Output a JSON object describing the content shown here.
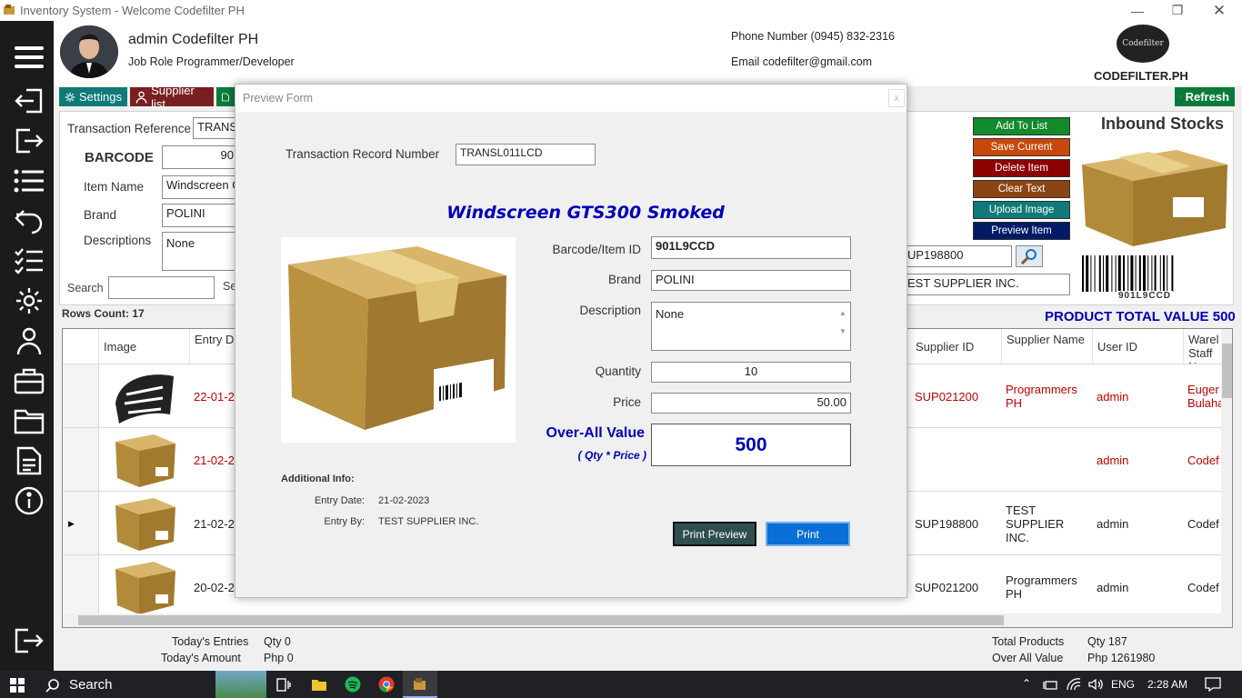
{
  "window": {
    "title": "Inventory System - Welcome Codefilter PH"
  },
  "header": {
    "user_name": "admin Codefilter PH",
    "job_role": "Job Role Programmer/Developer",
    "phone": "Phone Number (0945) 832-2316",
    "email": "Email codefilter@gmail.com",
    "logo_text": "Codefilter",
    "brand": "CODEFILTER.PH"
  },
  "toolbar": {
    "settings": "Settings",
    "supplier_list": "Supplier list",
    "refresh": "Refresh"
  },
  "form": {
    "transaction_reference_label": "Transaction Reference",
    "transaction_reference_value": "TRANSL",
    "barcode_label": "BARCODE",
    "barcode_value": "90",
    "item_name_label": "Item Name",
    "item_name_value": "Windscreen G",
    "brand_label": "Brand",
    "brand_value": "POLINI",
    "descriptions_label": "Descriptions",
    "descriptions_value": "None",
    "search_label": "Search",
    "search_value": "",
    "se_label": "Se",
    "supplier_id_value": "UP198800",
    "supplier_name_value": "EST SUPPLIER INC.",
    "section_title": "Inbound Stocks",
    "barcode_caption": "901L9CCD"
  },
  "actions": {
    "add": "Add To List",
    "save": "Save Current",
    "delete": "Delete Item",
    "clear": "Clear Text",
    "upload": "Upload Image",
    "preview": "Preview Item"
  },
  "summary": {
    "rows_count": "Rows Count: 17",
    "product_total": "PRODUCT TOTAL VALUE  500"
  },
  "grid": {
    "headers": {
      "image": "Image",
      "entry_date": "Entry Date",
      "supplier_id": "Supplier ID",
      "supplier_name": "Supplier Name",
      "user_id": "User ID",
      "warehouse": "Warel Staff N"
    },
    "rows": [
      {
        "date": "22-01-2",
        "supplier_id": "SUP021200",
        "supplier_name": "Programmers PH",
        "user": "admin",
        "staff": "Euger Bulaha",
        "red": true
      },
      {
        "date": "21-02-2",
        "supplier_id": "",
        "supplier_name": "",
        "user": "admin",
        "staff": "Codef",
        "red": true
      },
      {
        "date": "21-02-2",
        "supplier_id": "SUP198800",
        "supplier_name": "TEST SUPPLIER INC.",
        "user": "admin",
        "staff": "Codef",
        "red": false
      },
      {
        "date": "20-02-2",
        "supplier_id": "SUP021200",
        "supplier_name": "Programmers PH",
        "user": "admin",
        "staff": "Codef",
        "red": false
      }
    ]
  },
  "footer": {
    "today_entries_label": "Today's Entries",
    "today_entries_value": "Qty 0",
    "today_amount_label": "Today's Amount",
    "today_amount_value": "Php 0",
    "total_products_label": "Total Products",
    "total_products_value": "Qty 187",
    "overall_value_label": "Over All Value",
    "overall_value_value": "Php 1261980"
  },
  "modal": {
    "title": "Preview Form",
    "close": "x",
    "trn_label": "Transaction Record Number",
    "trn_value": "TRANSL011LCD",
    "item_title": "Windscreen GTS300 Smoked",
    "barcode_label": "Barcode/Item ID",
    "barcode_value": "901L9CCD",
    "brand_label": "Brand",
    "brand_value": "POLINI",
    "description_label": "Description",
    "description_value": "None",
    "quantity_label": "Quantity",
    "quantity_value": "10",
    "price_label": "Price",
    "price_value": "50.00",
    "overall_label": "Over-All Value",
    "overall_formula": "( Qty * Price )",
    "overall_value": "500",
    "additional_info": "Additional Info:",
    "entry_date_label": "Entry Date:",
    "entry_date_value": "21-02-2023",
    "entry_by_label": "Entry By:",
    "entry_by_value": "TEST SUPPLIER INC.",
    "print_preview": "Print Preview",
    "print": "Print"
  },
  "taskbar": {
    "search": "Search",
    "lang": "ENG",
    "time": "2:28 AM"
  },
  "colors": {
    "teal": "#0f7a78",
    "maroon": "#7a1f1f",
    "orange": "#c8480c",
    "darkred": "#8b0000",
    "brown": "#8b4513",
    "navy": "#001a66",
    "green": "#0a7a3a",
    "blue_title": "#0000b8"
  }
}
